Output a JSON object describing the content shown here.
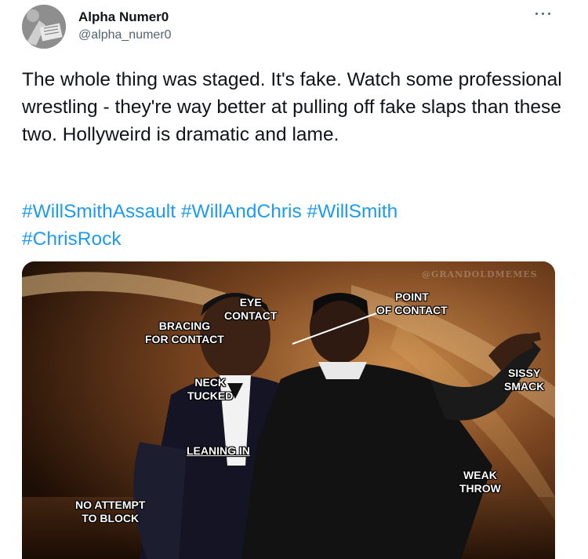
{
  "author": {
    "name": "Alpha Numer0",
    "handle": "@alpha_numer0"
  },
  "icons": {
    "more": "more-horizontal-icon"
  },
  "tweet": {
    "text": "The whole thing was staged. It's fake. Watch some professional wrestling - they're way better at pulling off fake slaps than these two. Hollyweird is dramatic and lame.",
    "hashtags": [
      "#WillSmithAssault",
      "#WillAndChris",
      "#WillSmith",
      "#ChrisRock"
    ]
  },
  "media": {
    "watermark": "@GRANDOLDMEMES",
    "labels": {
      "eye_contact": "EYE\nCONTACT",
      "bracing": "BRACING\nFOR CONTACT",
      "point_of_contact": "POINT\nOF CONTACT",
      "neck_tucked": "NECK\nTUCKED",
      "sissy_smack": "SISSY\nSMACK",
      "leaning_in": "LEANING IN",
      "weak_throw": "WEAK\nTHROW",
      "no_attempt": "NO ATTEMPT\nTO BLOCK"
    }
  }
}
